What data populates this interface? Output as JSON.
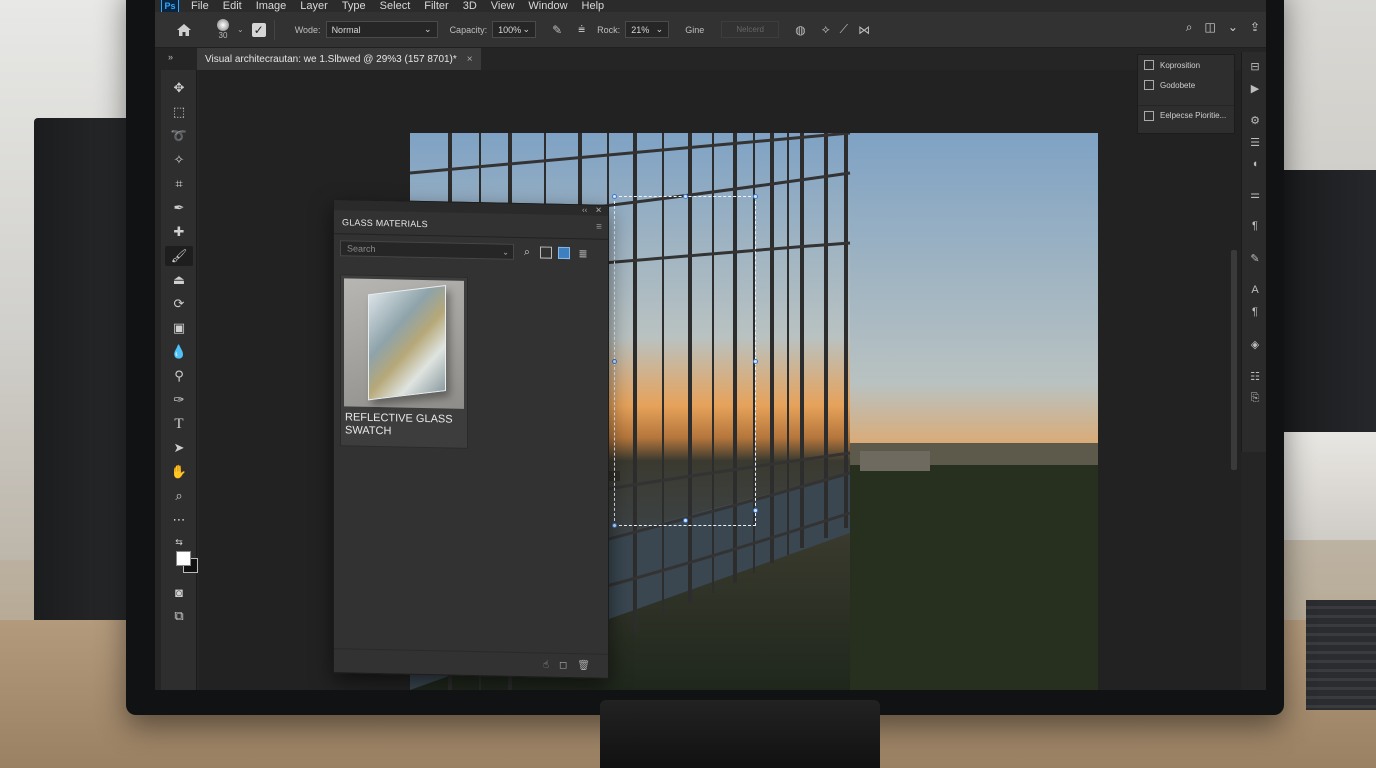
{
  "app": {
    "logo": "Ps"
  },
  "menu": [
    "File",
    "Edit",
    "Image",
    "Layer",
    "Type",
    "Select",
    "Filter",
    "3D",
    "View",
    "Window",
    "Help"
  ],
  "options_bar": {
    "brush_size": "30",
    "mode_label": "Wode:",
    "mode_value": "Normal",
    "capacity_label": "Capacity:",
    "capacity_value": "100%",
    "rock_label": "Rock:",
    "rock_value": "21%",
    "extra_label": "Gine",
    "disabled_field": "Nelcerd"
  },
  "document_tab": {
    "title": "Visual architecrautan: we 1.Slbwed @ 29%3 (157 8701)*",
    "close": "×"
  },
  "glass_panel": {
    "tab_label": "GLASS MATERIALS",
    "search_placeholder": "Search",
    "swatches": [
      {
        "name": "REFLECTIVE GLASS SWATCH"
      }
    ]
  },
  "right_panel": {
    "items": [
      {
        "label": "Koprosition"
      },
      {
        "label": "Godobete"
      },
      {
        "label": "Eelpecse Pioritie..."
      }
    ]
  },
  "selection": {
    "shape": "marquee-rectangle"
  },
  "icons": [
    "home-icon",
    "brush-icon",
    "search-icon",
    "panel-icon",
    "share-icon",
    "move-icon",
    "marquee-icon",
    "lasso-icon",
    "crop-icon",
    "eyedropper-icon",
    "healing-icon",
    "brush-tool-icon",
    "stamp-icon",
    "eraser-icon",
    "gradient-icon",
    "blur-icon",
    "dodge-icon",
    "pen-icon",
    "type-icon",
    "path-select-icon",
    "hand-icon",
    "zoom-icon",
    "more-icon"
  ]
}
